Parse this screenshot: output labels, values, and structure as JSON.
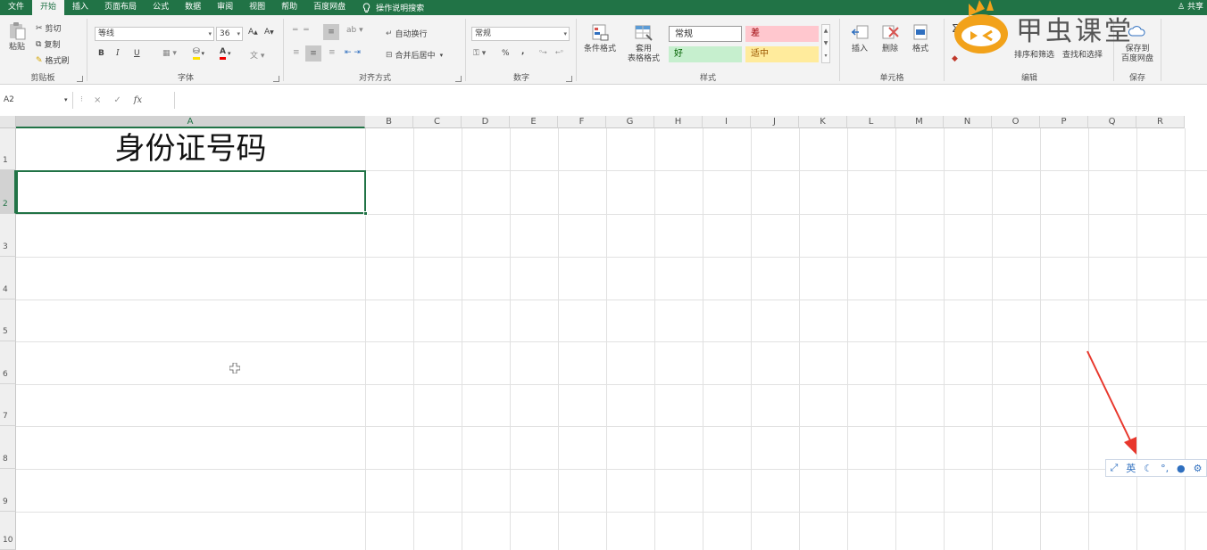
{
  "tabs": {
    "items": [
      "文件",
      "开始",
      "插入",
      "页面布局",
      "公式",
      "数据",
      "审阅",
      "视图",
      "帮助",
      "百度网盘"
    ],
    "active_index": 1,
    "tell_me": "操作说明搜索",
    "share": "共享"
  },
  "ribbon": {
    "clipboard": {
      "label": "剪贴板",
      "paste": "粘贴",
      "cut": "剪切",
      "copy": "复制",
      "format_painter": "格式刷"
    },
    "font": {
      "label": "字体",
      "name": "等线",
      "size": "36",
      "bold": "B",
      "italic": "I",
      "underline": "U"
    },
    "alignment": {
      "label": "对齐方式",
      "wrap": "自动换行",
      "merge": "合并后居中"
    },
    "number": {
      "label": "数字",
      "format": "常规",
      "percent": "%",
      "comma": ","
    },
    "styles": {
      "label": "样式",
      "conditional": "条件格式",
      "table_format_1": "套用",
      "table_format_2": "表格格式",
      "normal": "常规",
      "bad": "差",
      "good": "好",
      "neutral": "适中"
    },
    "cells": {
      "label": "单元格",
      "insert": "插入",
      "delete": "删除",
      "format": "格式"
    },
    "editing": {
      "label": "编辑",
      "sort_filter": "排序和筛选",
      "find_select": "查找和选择"
    },
    "save": {
      "label": "保存",
      "save_to_1": "保存到",
      "save_to_2": "百度网盘"
    }
  },
  "formula_bar": {
    "name_box": "A2",
    "cancel": "×",
    "enter": "✓",
    "fx": "fx",
    "value": ""
  },
  "grid": {
    "columns": [
      "A",
      "B",
      "C",
      "D",
      "E",
      "F",
      "G",
      "H",
      "I",
      "J",
      "K",
      "L",
      "M",
      "N",
      "O",
      "P",
      "Q",
      "R"
    ],
    "rows": [
      "1",
      "2",
      "3",
      "4",
      "5",
      "6",
      "7",
      "8",
      "9",
      "10"
    ],
    "selected_cell": "A2",
    "cells": {
      "A1": "身份证号码"
    }
  },
  "ime": {
    "mode": "英"
  },
  "watermark": {
    "text": "甲虫课堂"
  },
  "colors": {
    "excel_green": "#217346",
    "bad_fill": "#ffc7ce",
    "good_fill": "#c6efce",
    "neutral_fill": "#ffeb9c",
    "arrow": "#e8372c"
  }
}
